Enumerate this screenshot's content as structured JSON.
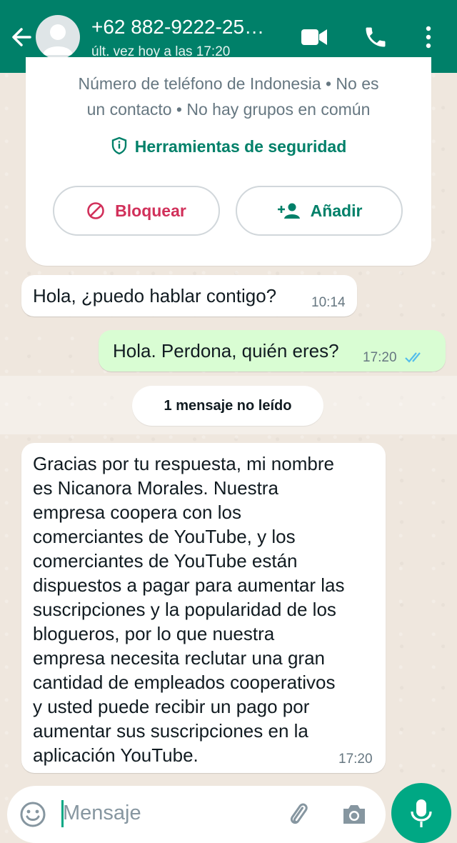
{
  "header": {
    "title": "+62 882-9222-25…",
    "status": "últ. vez hoy a las 17:20",
    "icons": [
      "back-arrow-icon",
      "avatar",
      "video-call-icon",
      "phone-icon",
      "more-vert-icon"
    ]
  },
  "info": {
    "line1": "Número de teléfono de Indonesia • No es",
    "line2": "un contacto • No hay grupos en común",
    "safety_label": "Herramientas de seguridad",
    "block_label": "Bloquear",
    "add_label": "Añadir"
  },
  "messages": [
    {
      "direction": "in",
      "text": "Hola, ¿puedo hablar contigo?",
      "time": "10:14"
    },
    {
      "direction": "out",
      "text": "Hola. Perdona, quién eres?",
      "time": "17:20",
      "status": "read"
    },
    {
      "direction": "in",
      "lines": [
        "Gracias por tu respuesta, mi nombre",
        "es Nicanora Morales. Nuestra",
        "empresa coopera con los",
        "comerciantes de YouTube, y los",
        "comerciantes de YouTube están",
        "dispuestos a pagar para aumentar las",
        "suscripciones y la popularidad de los",
        "blogueros, por lo que nuestra",
        "empresa necesita reclutar una gran",
        "cantidad de empleados cooperativos",
        "y usted puede recibir un pago por",
        "aumentar sus suscripciones en la",
        "aplicación YouTube."
      ],
      "time": "17:20"
    }
  ],
  "unread_divider": "1 mensaje no leído",
  "composer": {
    "placeholder": "Mensaje"
  },
  "colors": {
    "header": "#008069",
    "accent": "#00a884",
    "block": "#d1305a",
    "outgoing_bubble": "#d9fdd3",
    "read_ticks": "#53bdeb"
  }
}
